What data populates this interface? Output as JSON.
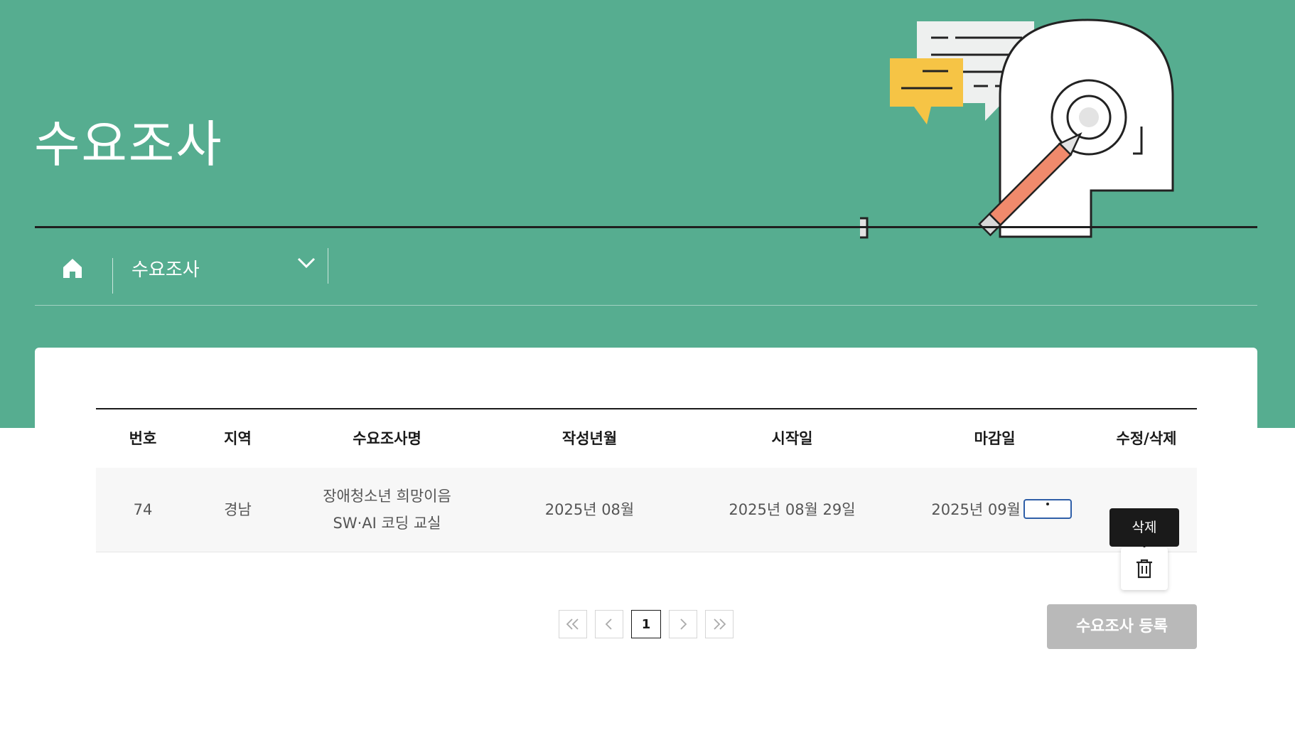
{
  "header": {
    "title": "수요조사"
  },
  "breadcrumb": {
    "current": "수요조사",
    "home_icon": "home-icon",
    "dropdown_icon": "chevron-down-icon"
  },
  "table": {
    "columns": [
      "번호",
      "지역",
      "수요조사명",
      "작성년월",
      "시작일",
      "마감일",
      "수정/삭제"
    ],
    "rows": [
      {
        "no": "74",
        "region": "경남",
        "name_line1": "장애청소년 희망이음",
        "name_line2": "SW·AI 코딩 교실",
        "written": "2025년 08월",
        "start": "2025년 08월 29일",
        "end": "2025년 09월 19일"
      }
    ]
  },
  "actions": {
    "delete_tooltip": "삭제",
    "edit_icon": "edit-icon",
    "delete_icon": "trash-icon"
  },
  "pagination": {
    "current_page": "1",
    "first_icon": "double-chevron-left-icon",
    "prev_icon": "chevron-left-icon",
    "next_icon": "chevron-right-icon",
    "last_icon": "double-chevron-right-icon"
  },
  "register_button": "수요조사 등록",
  "colors": {
    "brand_green": "#56ad90",
    "dark": "#1a1a1a",
    "disabled_button": "#b9b9b9",
    "edit_border": "#2f5fa8",
    "pencil": "#f08a6c",
    "bubble_yellow": "#f6c445"
  }
}
